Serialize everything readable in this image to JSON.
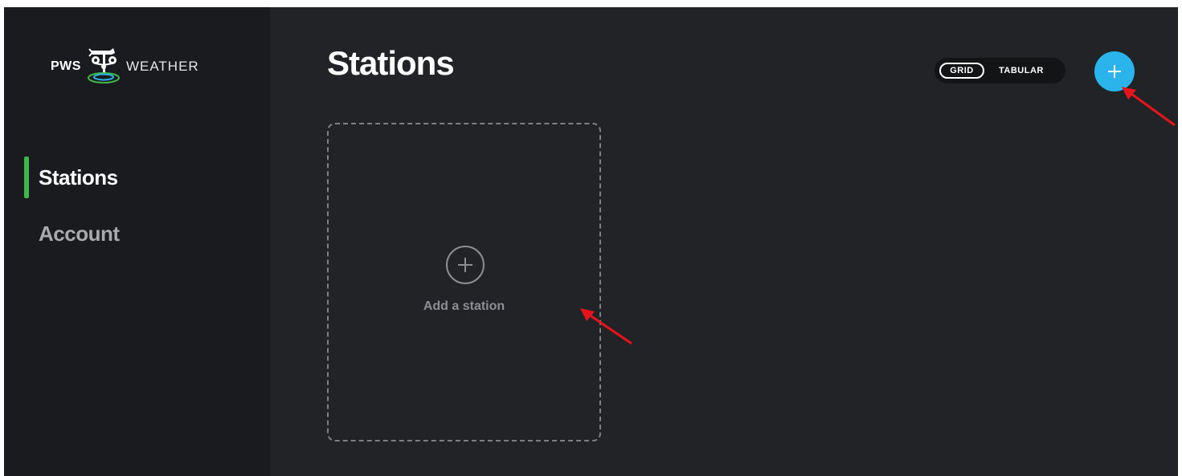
{
  "sidebar": {
    "logo": {
      "left_text": "PWS",
      "right_text": "WEATHER",
      "icon": "weather-vane-logo-icon"
    },
    "nav": [
      {
        "label": "Stations",
        "active": true
      },
      {
        "label": "Account",
        "active": false
      }
    ]
  },
  "main": {
    "title": "Stations",
    "view_toggle": {
      "options": [
        "GRID",
        "TABULAR"
      ],
      "selected": "GRID"
    },
    "add_button": {
      "icon": "plus-icon"
    },
    "add_card": {
      "label": "Add a station",
      "icon": "plus-circle-icon"
    }
  },
  "annotations": [
    {
      "type": "arrow",
      "color": "#e8141b",
      "target": "add-station-button"
    },
    {
      "type": "arrow",
      "color": "#e8141b",
      "target": "add-station-card"
    }
  ],
  "colors": {
    "background": "#222326",
    "sidebar": "#1a1b1e",
    "active_indicator": "#3fb54a",
    "accent": "#2bb3ec",
    "annotation": "#e8141b"
  }
}
